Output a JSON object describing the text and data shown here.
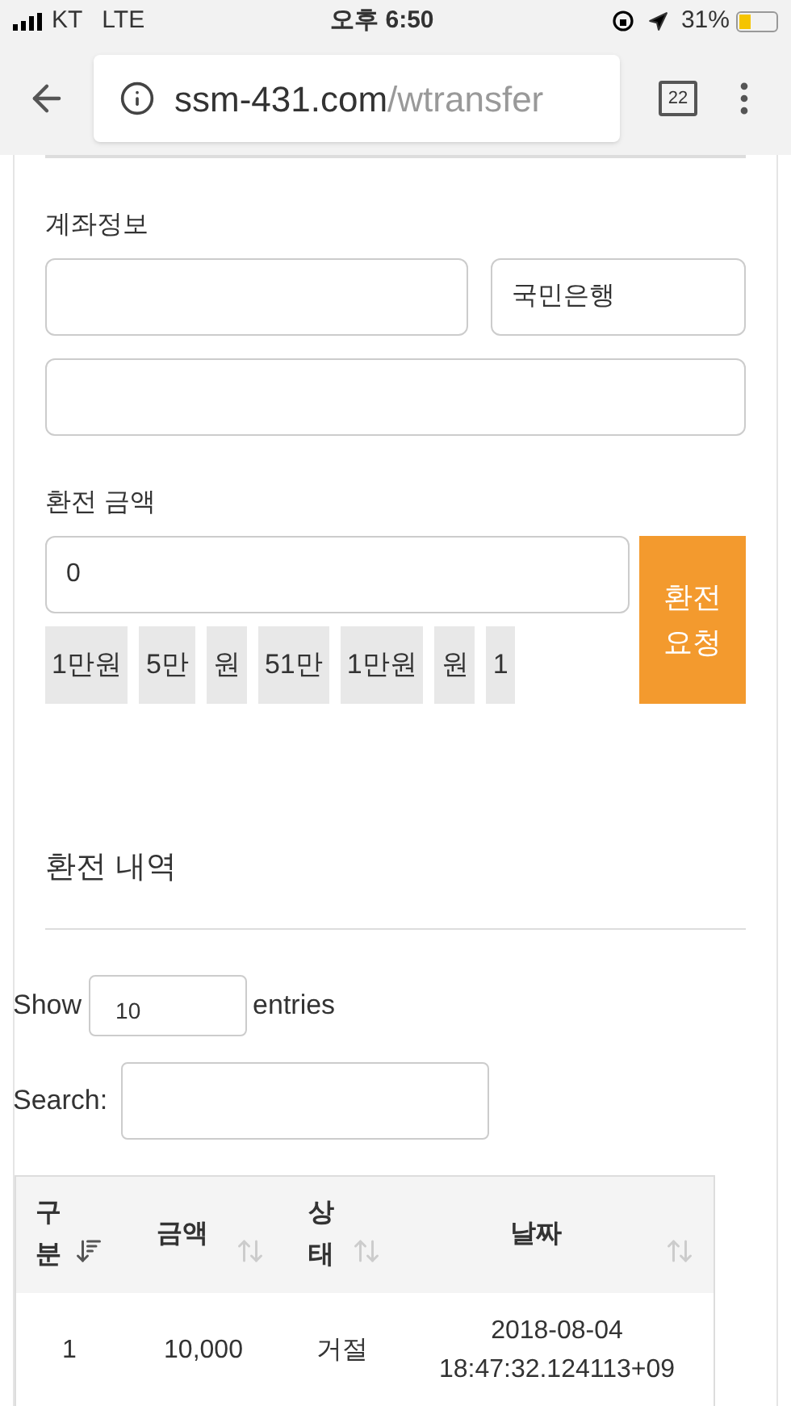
{
  "status_bar": {
    "carrier": "KT",
    "network": "LTE",
    "time": "오후 6:50",
    "battery": "31%"
  },
  "browser": {
    "url_host": "ssm-431.com",
    "url_path": "/wtransfer",
    "tab_count": "22"
  },
  "account": {
    "label": "계좌정보",
    "bank": "국민은행"
  },
  "amount": {
    "label": "환전 금액",
    "value": "0",
    "request_button": "환전\n요청",
    "quick_buttons": [
      "1만원",
      "5만",
      "원",
      "51만",
      "1만원",
      "원",
      "1"
    ]
  },
  "history": {
    "title": "환전 내역",
    "show_label": "Show",
    "entries_value": "10",
    "entries_label": "entries",
    "search_label": "Search:"
  },
  "table": {
    "columns": [
      {
        "label": "구분",
        "sorted": true
      },
      {
        "label": "금액",
        "sorted": false
      },
      {
        "label": "상태",
        "sorted": false
      },
      {
        "label": "날짜",
        "sorted": false
      }
    ],
    "rows": [
      [
        "1",
        "10,000",
        "거절",
        "2018-08-04\n18:47:32.124113+09"
      ]
    ]
  }
}
